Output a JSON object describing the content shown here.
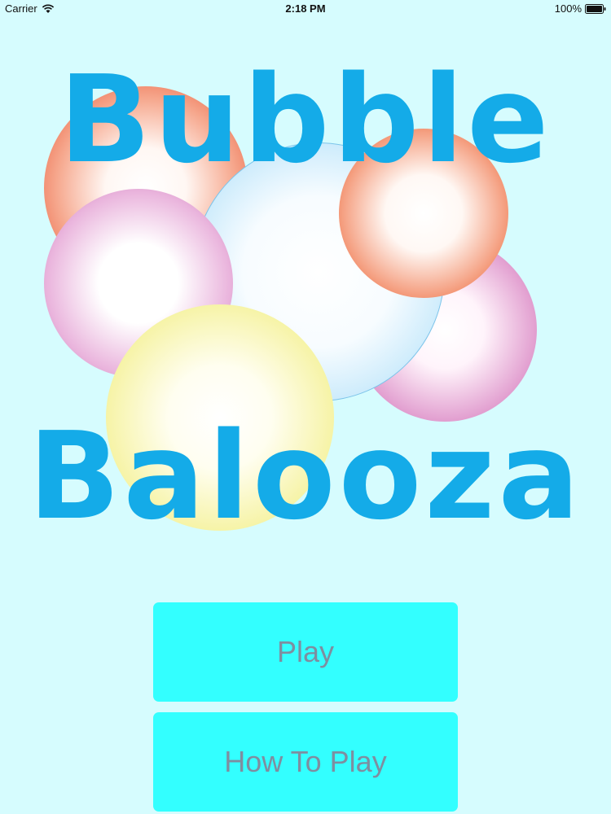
{
  "status_bar": {
    "carrier": "Carrier",
    "time": "2:18 PM",
    "battery": "100%"
  },
  "logo": {
    "line1": "Bubble",
    "line2": "Balooza",
    "text_color": "#14abe8",
    "bubble_colors": [
      "orange",
      "pink",
      "light-blue",
      "pink",
      "orange",
      "yellow"
    ]
  },
  "menu": {
    "play_label": "Play",
    "how_to_play_label": "How To Play",
    "button_color": "#33ffff",
    "button_text_color": "#7e8ea0"
  },
  "background_color": "#d6fcfe"
}
